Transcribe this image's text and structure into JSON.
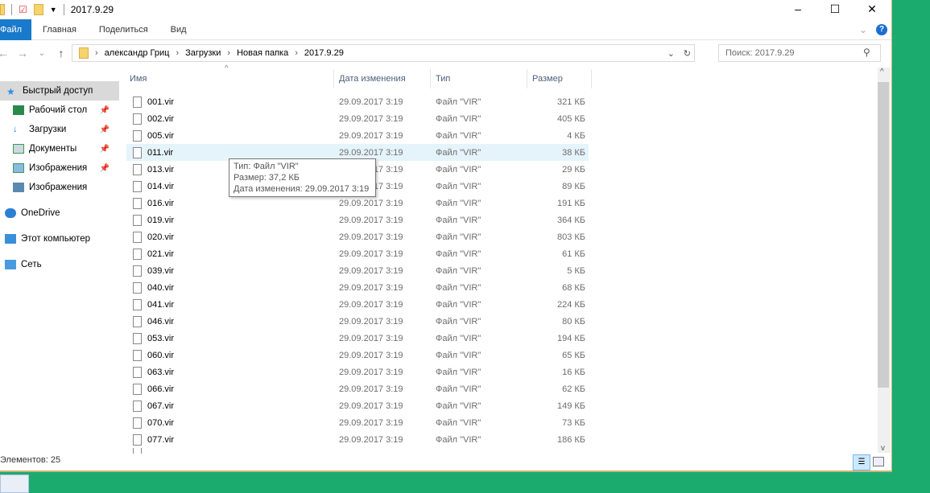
{
  "window": {
    "title": "2017.9.29",
    "minimize": "–",
    "maximize": "☐",
    "close": "✕"
  },
  "ribbon": {
    "tabs": [
      "Файл",
      "Главная",
      "Поделиться",
      "Вид"
    ],
    "help": "?"
  },
  "address": {
    "crumbs": [
      "александр Гриц",
      "Загрузки",
      "Новая папка",
      "2017.9.29"
    ],
    "search_placeholder": "Поиск: 2017.9.29"
  },
  "sidebar": [
    {
      "label": "Быстрый доступ",
      "pinned": false
    },
    {
      "label": "Рабочий стол",
      "pinned": true
    },
    {
      "label": "Загрузки",
      "pinned": true
    },
    {
      "label": "Документы",
      "pinned": true
    },
    {
      "label": "Изображения",
      "pinned": true
    },
    {
      "label": "Изображения",
      "pinned": false
    },
    {
      "label": "OneDrive",
      "pinned": false
    },
    {
      "label": "Этот компьютер",
      "pinned": false
    },
    {
      "label": "Сеть",
      "pinned": false
    }
  ],
  "columns": [
    "Имя",
    "Дата изменения",
    "Тип",
    "Размер"
  ],
  "files": [
    [
      "001.vir",
      "29.09.2017 3:19",
      "Файл \"VIR\"",
      "321 КБ"
    ],
    [
      "002.vir",
      "29.09.2017 3:19",
      "Файл \"VIR\"",
      "405 КБ"
    ],
    [
      "005.vir",
      "29.09.2017 3:19",
      "Файл \"VIR\"",
      "4 КБ"
    ],
    [
      "011.vir",
      "29.09.2017 3:19",
      "Файл \"VIR\"",
      "38 КБ"
    ],
    [
      "013.vir",
      "29.09.2017 3:19",
      "Файл \"VIR\"",
      "29 КБ"
    ],
    [
      "014.vir",
      "29.09.2017 3:19",
      "Файл \"VIR\"",
      "89 КБ"
    ],
    [
      "016.vir",
      "29.09.2017 3:19",
      "Файл \"VIR\"",
      "191 КБ"
    ],
    [
      "019.vir",
      "29.09.2017 3:19",
      "Файл \"VIR\"",
      "364 КБ"
    ],
    [
      "020.vir",
      "29.09.2017 3:19",
      "Файл \"VIR\"",
      "803 КБ"
    ],
    [
      "021.vir",
      "29.09.2017 3:19",
      "Файл \"VIR\"",
      "61 КБ"
    ],
    [
      "039.vir",
      "29.09.2017 3:19",
      "Файл \"VIR\"",
      "5 КБ"
    ],
    [
      "040.vir",
      "29.09.2017 3:19",
      "Файл \"VIR\"",
      "68 КБ"
    ],
    [
      "041.vir",
      "29.09.2017 3:19",
      "Файл \"VIR\"",
      "224 КБ"
    ],
    [
      "046.vir",
      "29.09.2017 3:19",
      "Файл \"VIR\"",
      "80 КБ"
    ],
    [
      "053.vir",
      "29.09.2017 3:19",
      "Файл \"VIR\"",
      "194 КБ"
    ],
    [
      "060.vir",
      "29.09.2017 3:19",
      "Файл \"VIR\"",
      "65 КБ"
    ],
    [
      "063.vir",
      "29.09.2017 3:19",
      "Файл \"VIR\"",
      "16 КБ"
    ],
    [
      "066.vir",
      "29.09.2017 3:19",
      "Файл \"VIR\"",
      "62 КБ"
    ],
    [
      "067.vir",
      "29.09.2017 3:19",
      "Файл \"VIR\"",
      "149 КБ"
    ],
    [
      "070.vir",
      "29.09.2017 3:19",
      "Файл \"VIR\"",
      "73 КБ"
    ],
    [
      "077.vir",
      "29.09.2017 3:19",
      "Файл \"VIR\"",
      "186 КБ"
    ]
  ],
  "tooltip": [
    "Тип: Файл \"VIR\"",
    "Размер: 37,2 КБ",
    "Дата изменения: 29.09.2017 3:19"
  ],
  "status": "Элементов: 25"
}
